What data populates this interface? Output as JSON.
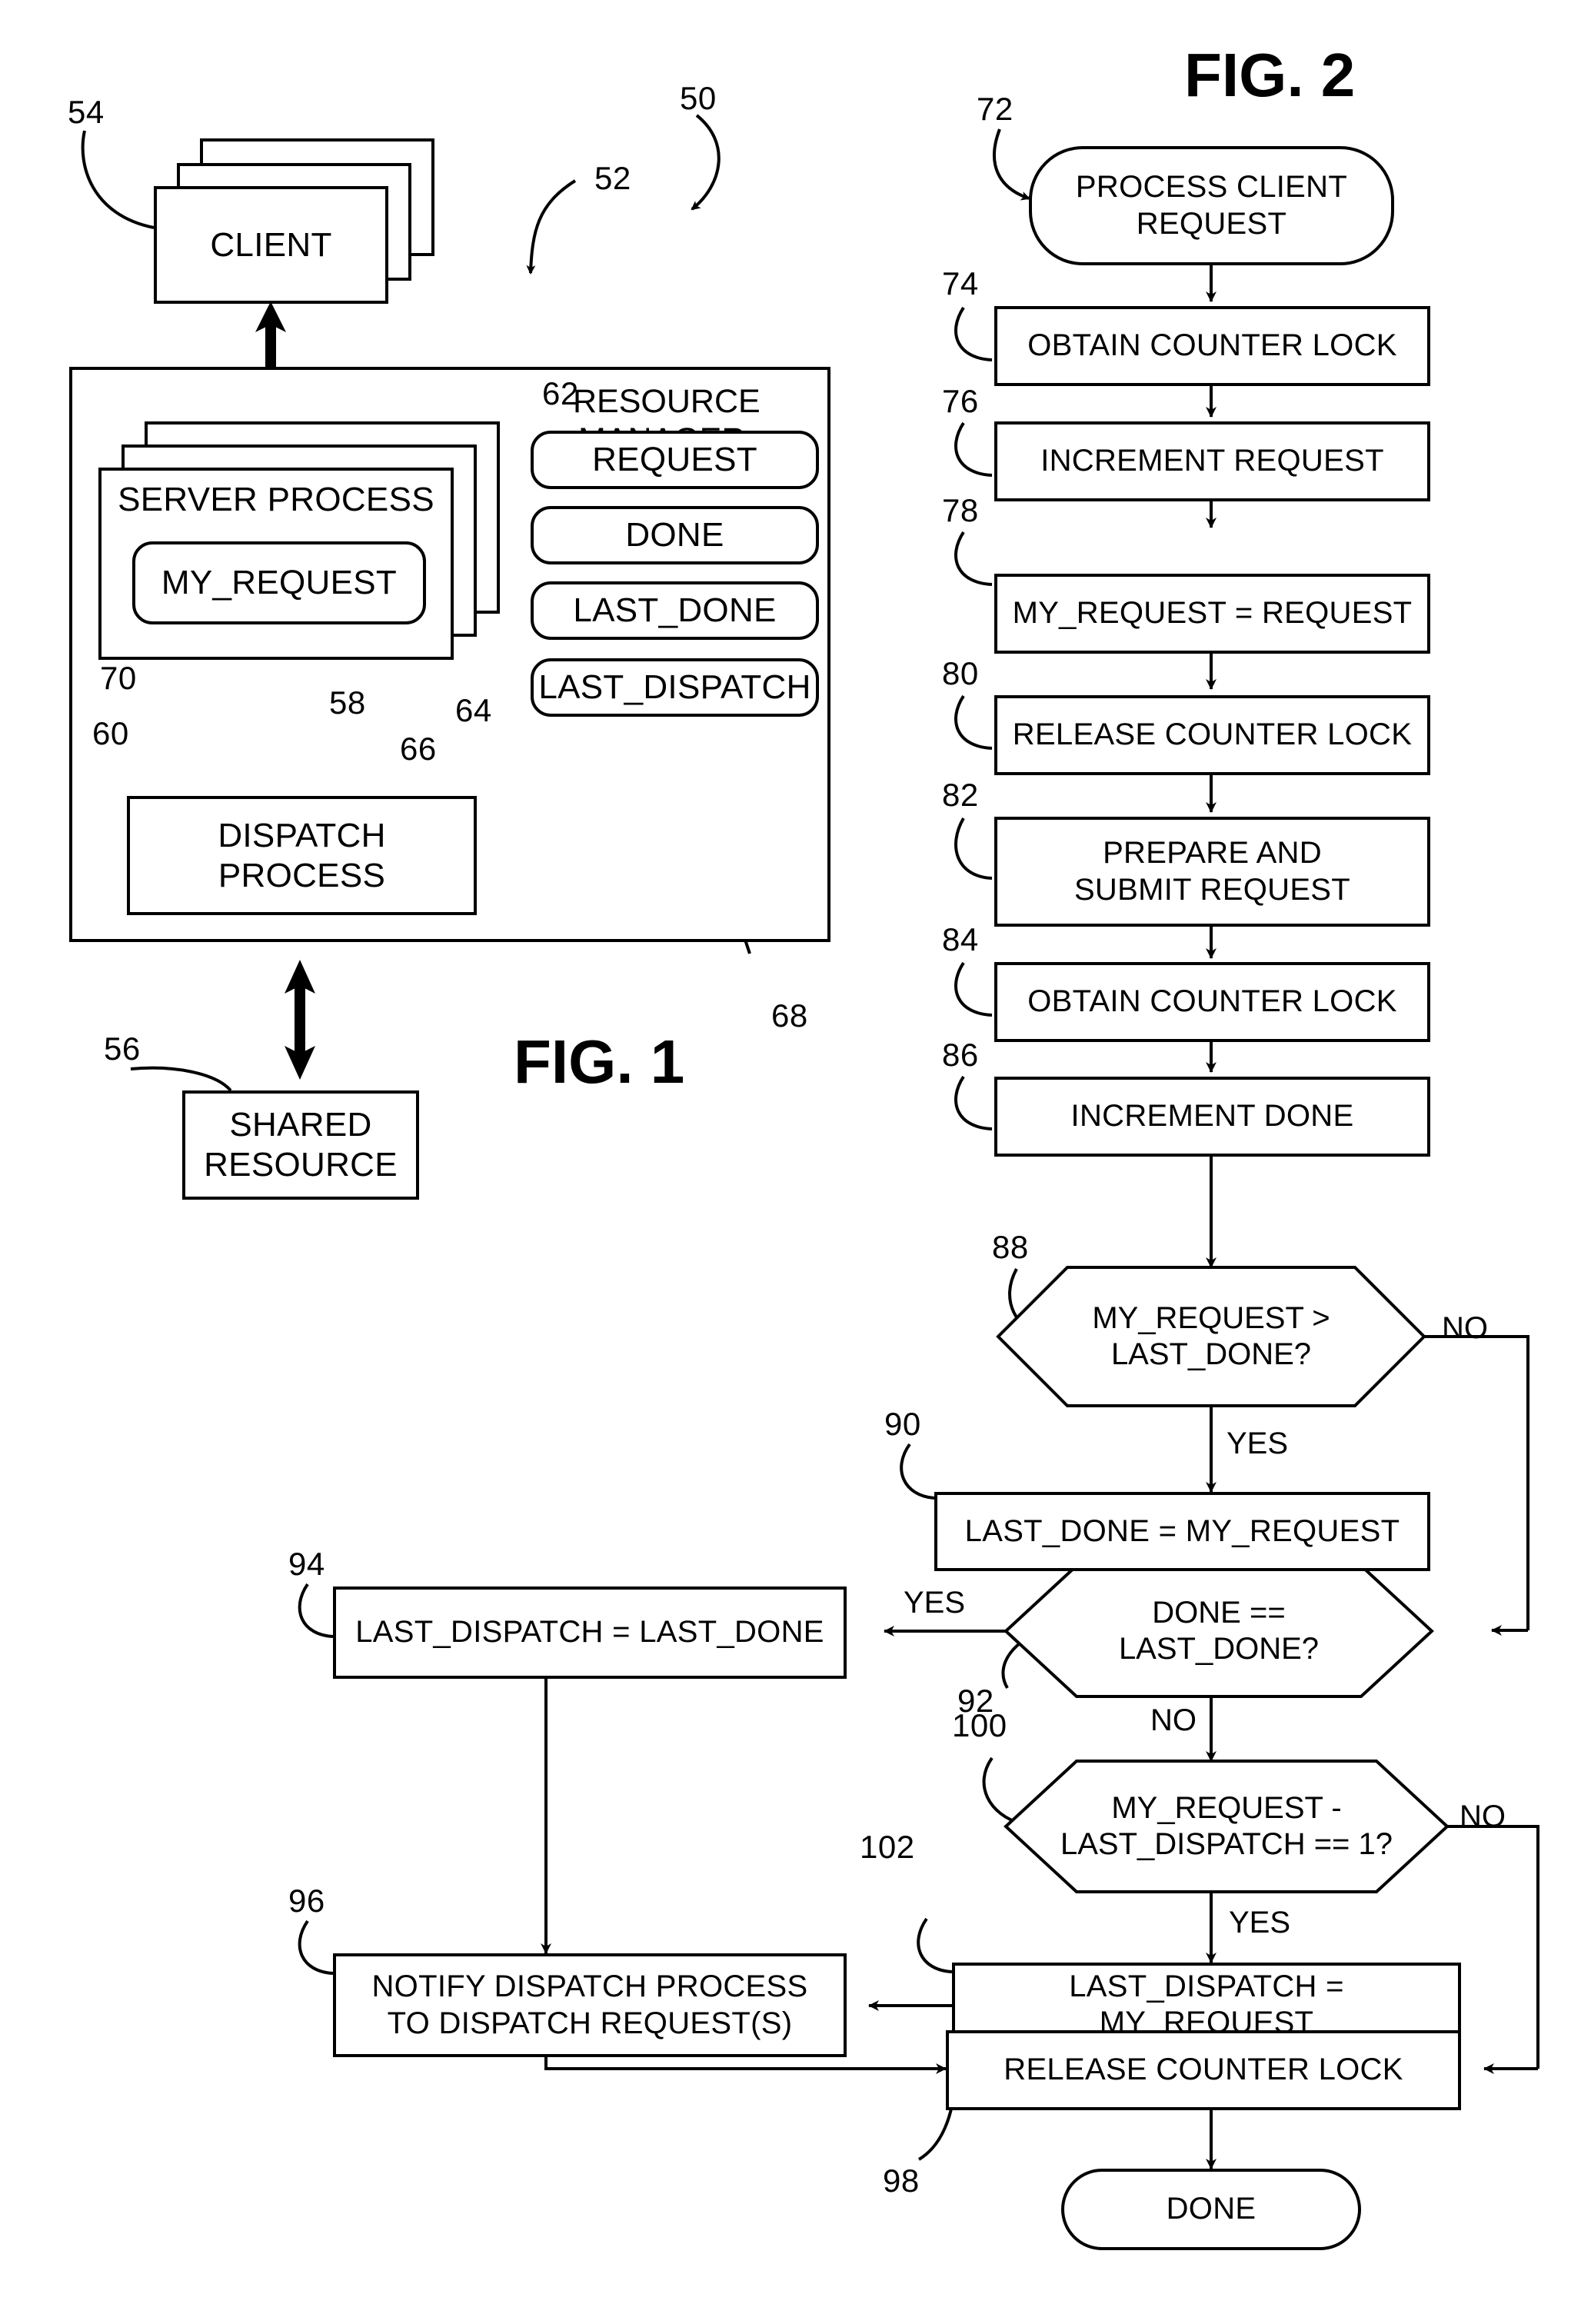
{
  "figure1": {
    "title": "FIG. 1",
    "ref_50": "50",
    "ref_52": "52",
    "ref_54": "54",
    "ref_56": "56",
    "ref_58": "58",
    "ref_60": "60",
    "ref_62": "62",
    "ref_64": "64",
    "ref_66": "66",
    "ref_68": "68",
    "ref_70": "70",
    "client": "CLIENT",
    "resource_manager_line1": "RESOURCE",
    "resource_manager_line2": "MANAGER",
    "server_process": "SERVER PROCESS",
    "my_request": "MY_REQUEST",
    "dispatch_process_line1": "DISPATCH",
    "dispatch_process_line2": "PROCESS",
    "shared_resource_line1": "SHARED",
    "shared_resource_line2": "RESOURCE",
    "counters": {
      "request": "REQUEST",
      "done": "DONE",
      "last_done": "LAST_DONE",
      "last_dispatch": "LAST_DISPATCH"
    }
  },
  "figure2": {
    "title": "FIG. 2",
    "steps": {
      "s72": {
        "ref": "72",
        "text": "PROCESS CLIENT\nREQUEST",
        "line1": "PROCESS CLIENT",
        "line2": "REQUEST",
        "shape": "terminal"
      },
      "s74": {
        "ref": "74",
        "text": "OBTAIN COUNTER LOCK",
        "shape": "process"
      },
      "s76": {
        "ref": "76",
        "text": "INCREMENT REQUEST",
        "shape": "process"
      },
      "s78": {
        "ref": "78",
        "text": "MY_REQUEST = REQUEST",
        "shape": "process"
      },
      "s80": {
        "ref": "80",
        "text": "RELEASE COUNTER LOCK",
        "shape": "process"
      },
      "s82": {
        "ref": "82",
        "line1": "PREPARE AND",
        "line2": "SUBMIT REQUEST",
        "shape": "process"
      },
      "s84": {
        "ref": "84",
        "text": "OBTAIN COUNTER LOCK",
        "shape": "process"
      },
      "s86": {
        "ref": "86",
        "text": "INCREMENT DONE",
        "shape": "process"
      },
      "s88": {
        "ref": "88",
        "line1": "MY_REQUEST >",
        "line2": "LAST_DONE?",
        "shape": "decision",
        "yes": "YES",
        "no": "NO"
      },
      "s90": {
        "ref": "90",
        "text": "LAST_DONE = MY_REQUEST",
        "shape": "process"
      },
      "s92": {
        "ref": "92",
        "line1": "DONE ==",
        "line2": "LAST_DONE?",
        "shape": "decision",
        "yes": "YES",
        "no": "NO"
      },
      "s94": {
        "ref": "94",
        "text": "LAST_DISPATCH = LAST_DONE",
        "shape": "process"
      },
      "s96": {
        "ref": "96",
        "line1": "NOTIFY DISPATCH PROCESS",
        "line2": "TO DISPATCH REQUEST(S)",
        "shape": "process"
      },
      "s98": {
        "ref": "98",
        "text": "RELEASE COUNTER LOCK",
        "shape": "process"
      },
      "s100": {
        "ref": "100",
        "line1": "MY_REQUEST -",
        "line2": "LAST_DISPATCH == 1?",
        "shape": "decision",
        "yes": "YES",
        "no": "NO"
      },
      "s102": {
        "ref": "102",
        "text": "LAST_DISPATCH = MY_REQUEST",
        "shape": "process"
      },
      "send": {
        "text": "DONE",
        "shape": "terminal"
      }
    },
    "edge_labels": {
      "yes88": "YES",
      "no88": "NO",
      "yes92": "YES",
      "no92": "NO",
      "yes100": "YES",
      "no100": "NO"
    }
  }
}
